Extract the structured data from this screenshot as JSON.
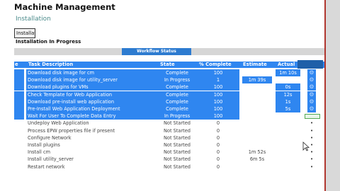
{
  "header": {
    "title": "Machine Management",
    "subtitle": "Installation",
    "install_button": "Installation",
    "section": "Installation In Progress"
  },
  "workflow": {
    "label": "Workflow Status"
  },
  "table": {
    "columns": [
      "Task Description",
      "State",
      "% Complete",
      "Estimate",
      "Actual"
    ],
    "col_num": "e",
    "rows": [
      {
        "num": "",
        "desc": "Download disk image for cm",
        "state": "Complete",
        "pct": "100",
        "est": "",
        "act": "1m 10s",
        "status": "done",
        "icon": "gear"
      },
      {
        "num": "",
        "desc": "Download disk image for utility_server",
        "state": "In Progress",
        "pct": "1",
        "est": "1m 39s",
        "act": "",
        "status": "done",
        "icon": "gear"
      },
      {
        "num": "",
        "desc": "Download plugins for VMs",
        "state": "Complete",
        "pct": "100",
        "est": "",
        "act": "0s",
        "status": "done",
        "icon": "gear"
      },
      {
        "num": "",
        "desc": "Check Template for Web Application",
        "state": "Complete",
        "pct": "100",
        "est": "",
        "act": "12s",
        "status": "done",
        "icon": "gear"
      },
      {
        "num": "",
        "desc": "Download pre-install web application",
        "state": "Complete",
        "pct": "100",
        "est": "",
        "act": "1s",
        "status": "done",
        "icon": "gear"
      },
      {
        "num": "",
        "desc": "Pre-Install Web Application Deployment",
        "state": "Complete",
        "pct": "100",
        "est": "",
        "act": "5s",
        "status": "done",
        "icon": "gear"
      },
      {
        "num": "",
        "desc": "Wait For User To Complete Data Entry",
        "state": "In Progress",
        "pct": "100",
        "est": "",
        "act": "",
        "status": "done",
        "icon": "bar"
      },
      {
        "num": "",
        "desc": "Undeploy Web Application",
        "state": "Not Started",
        "pct": "0",
        "est": "",
        "act": "",
        "status": "todo",
        "icon": "dot"
      },
      {
        "num": "",
        "desc": "Process EPW properties file if present",
        "state": "Not Started",
        "pct": "0",
        "est": "",
        "act": "",
        "status": "todo",
        "icon": "dot"
      },
      {
        "num": "",
        "desc": "Configure Network",
        "state": "Not Started",
        "pct": "0",
        "est": "",
        "act": "",
        "status": "todo",
        "icon": "dot"
      },
      {
        "num": "",
        "desc": "Install plugins",
        "state": "Not Started",
        "pct": "0",
        "est": "",
        "act": "",
        "status": "todo",
        "icon": "dot"
      },
      {
        "num": "",
        "desc": "Install cm",
        "state": "Not Started",
        "pct": "0",
        "est": "1m 52s",
        "act": "",
        "status": "todo",
        "icon": "dot"
      },
      {
        "num": "",
        "desc": "Install utility_server",
        "state": "Not Started",
        "pct": "0",
        "est": "6m 5s",
        "act": "",
        "status": "todo",
        "icon": "dot"
      },
      {
        "num": "",
        "desc": "Restart network",
        "state": "Not Started",
        "pct": "0",
        "est": "",
        "act": "",
        "status": "todo",
        "icon": "dot"
      }
    ]
  },
  "colors": {
    "accent": "#2f86f0",
    "header_dark": "#1f5fa8",
    "frame_red": "#b0362e"
  },
  "icons": {
    "gear": "gear-icon",
    "dot": "bullet-icon",
    "bar": "progress-bar-icon",
    "cursor": "mouse-cursor-icon"
  }
}
